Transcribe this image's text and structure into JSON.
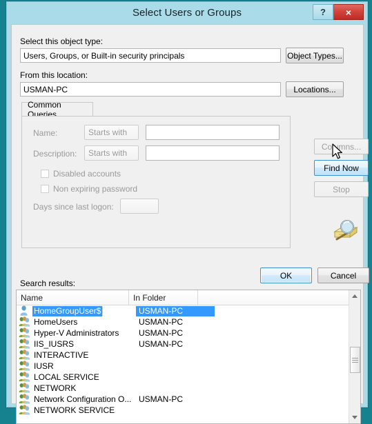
{
  "window": {
    "title": "Select Users or Groups",
    "help_button": "?",
    "close_button": "×"
  },
  "object_type": {
    "label": "Select this object type:",
    "value": "Users, Groups, or Built-in security principals",
    "button": "Object Types..."
  },
  "location": {
    "label": "From this location:",
    "value": "USMAN-PC",
    "button": "Locations..."
  },
  "common_queries": {
    "tab_label": "Common Queries",
    "name_label": "Name:",
    "name_operator": "Starts with",
    "name_value": "",
    "description_label": "Description:",
    "description_operator": "Starts with",
    "description_value": "",
    "disabled_accounts_label": "Disabled accounts",
    "non_expiring_password_label": "Non expiring password",
    "days_label": "Days since last logon:",
    "days_value": ""
  },
  "side_buttons": {
    "columns": "Columns...",
    "find_now": "Find Now",
    "stop": "Stop"
  },
  "dialog_buttons": {
    "ok": "OK",
    "cancel": "Cancel"
  },
  "results": {
    "label": "Search results:",
    "columns": [
      "Name",
      "In Folder"
    ],
    "rows": [
      {
        "icon": "user-icon",
        "name": "HomeGroupUser$",
        "folder": "USMAN-PC",
        "selected": true
      },
      {
        "icon": "group-icon",
        "name": "HomeUsers",
        "folder": "USMAN-PC",
        "selected": false
      },
      {
        "icon": "group-icon",
        "name": "Hyper-V Administrators",
        "folder": "USMAN-PC",
        "selected": false
      },
      {
        "icon": "group-icon",
        "name": "IIS_IUSRS",
        "folder": "USMAN-PC",
        "selected": false
      },
      {
        "icon": "group-icon",
        "name": "INTERACTIVE",
        "folder": "",
        "selected": false
      },
      {
        "icon": "group-icon",
        "name": "IUSR",
        "folder": "",
        "selected": false
      },
      {
        "icon": "group-icon",
        "name": "LOCAL SERVICE",
        "folder": "",
        "selected": false
      },
      {
        "icon": "group-icon",
        "name": "NETWORK",
        "folder": "",
        "selected": false
      },
      {
        "icon": "group-icon",
        "name": "Network Configuration O...",
        "folder": "USMAN-PC",
        "selected": false
      },
      {
        "icon": "group-icon",
        "name": "NETWORK SERVICE",
        "folder": "",
        "selected": false
      },
      {
        "icon": "group-icon",
        "name": "",
        "folder": "",
        "selected": false
      }
    ]
  },
  "colors": {
    "window_frame": "#a9dbe8",
    "desktop": "#16828f",
    "selection": "#3399ff",
    "close_button": "#c9302c",
    "accent_focus": "#3c8fd0"
  }
}
